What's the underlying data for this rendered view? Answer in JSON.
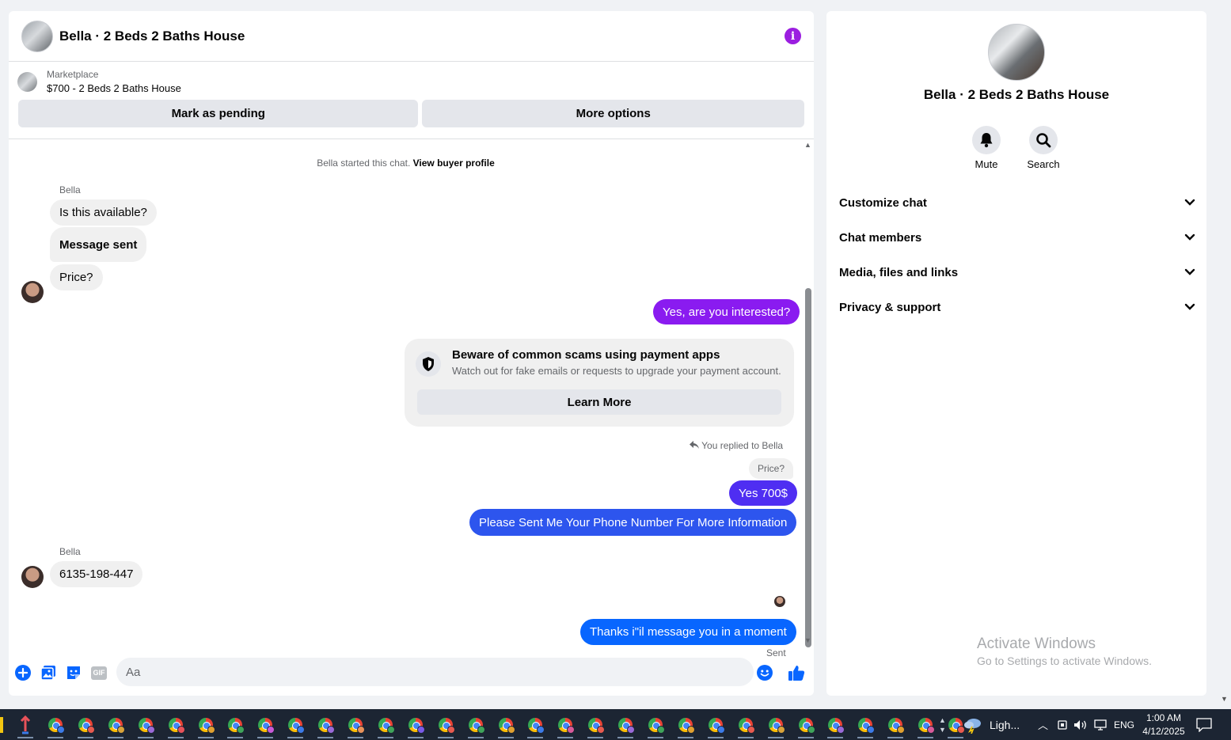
{
  "chat": {
    "title": "Bella · 2 Beds 2 Baths House",
    "marketplace_label": "Marketplace",
    "listing": "$700 - 2 Beds 2 Baths House",
    "mark_pending": "Mark as pending",
    "more_options": "More options",
    "started_text": "Bella started this chat.",
    "view_profile": "View buyer profile",
    "sender_name": "Bella",
    "sender_name_2": "Bella",
    "messages": {
      "m1": "Is this available?",
      "m2": "Message sent",
      "m3": "Price?",
      "m4": "Yes, are you interested?",
      "m5": "Yes 700$",
      "m6": "Please Sent Me Your Phone Number For More Information",
      "m7": "6135-198-447",
      "m8": "Thanks i\"il message you in a moment"
    },
    "scam": {
      "title": "Beware of common scams using payment apps",
      "body": "Watch out for fake emails or requests to upgrade your payment account.",
      "button": "Learn More"
    },
    "replied": "You replied to Bella",
    "quoted": "Price?",
    "sent_status": "Sent",
    "composer_placeholder": "Aa",
    "gif_label": "GIF"
  },
  "side": {
    "name": "Bella · 2 Beds 2 Baths House",
    "mute": "Mute",
    "search": "Search",
    "sections": [
      "Customize chat",
      "Chat members",
      "Media, files and links",
      "Privacy & support"
    ],
    "activate_title": "Activate Windows",
    "activate_sub": "Go to Settings to activate Windows."
  },
  "taskbar": {
    "weather": "Ligh...",
    "lang": "ENG",
    "time": "1:00 AM",
    "date": "4/12/2025",
    "chrome_badges": [
      "#3c7be8",
      "#e85a4f",
      "#d9a33a",
      "#9a6ad8",
      "#e8525a",
      "#e0a030",
      "#3fa45a",
      "#c85ad8",
      "#3c7be8",
      "#9a6ad8",
      "#e8925a",
      "#3fa45a",
      "#7a5ae8",
      "#e85a4f",
      "#3fa45a",
      "#e0a030",
      "#3c7be8",
      "#d85a9a",
      "#e85a4f",
      "#9a6ad8",
      "#3fa45a",
      "#e0a030",
      "#3c7be8",
      "#e85a4f",
      "#d9a33a",
      "#3fa45a",
      "#9a6ad8",
      "#3c7be8",
      "#e0a030",
      "#d85a9a",
      "#e85a4f"
    ]
  },
  "colors": {
    "accent": "#0866ff",
    "purple_bubble": "#8a1bf0",
    "info_icon": "#9b1ee0"
  }
}
